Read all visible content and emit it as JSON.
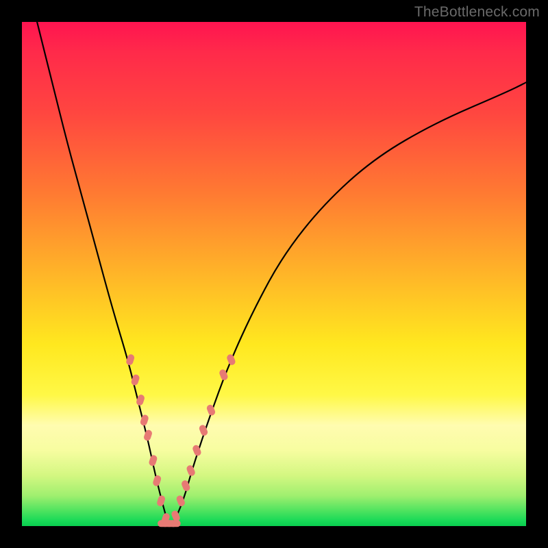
{
  "watermark": "TheBottleneck.com",
  "colors": {
    "frame": "#000000",
    "curve": "#000000",
    "marker": "#e77a74",
    "gradient_top": "#ff1450",
    "gradient_bottom": "#0ace50"
  },
  "chart_data": {
    "type": "line",
    "title": "",
    "xlabel": "",
    "ylabel": "",
    "xlim": [
      0,
      100
    ],
    "ylim": [
      0,
      100
    ],
    "series": [
      {
        "name": "bottleneck-curve",
        "x": [
          3,
          6,
          9,
          12,
          15,
          18,
          21,
          23,
          25,
          26.5,
          28,
          29,
          30,
          32,
          34,
          37,
          41,
          46,
          52,
          60,
          70,
          82,
          96,
          100
        ],
        "y": [
          100,
          88,
          76,
          65,
          54,
          43,
          33,
          25,
          17,
          10,
          4,
          0.5,
          0.5,
          5,
          12,
          21,
          32,
          43,
          54,
          64,
          73,
          80,
          86,
          88
        ]
      }
    ],
    "markers": [
      {
        "name": "left-arm",
        "points": [
          {
            "x": 21.5,
            "y": 33
          },
          {
            "x": 22.5,
            "y": 29
          },
          {
            "x": 23.5,
            "y": 25
          },
          {
            "x": 24.3,
            "y": 21
          },
          {
            "x": 25.0,
            "y": 18
          },
          {
            "x": 26.0,
            "y": 13
          },
          {
            "x": 26.8,
            "y": 9
          },
          {
            "x": 27.6,
            "y": 5
          },
          {
            "x": 28.5,
            "y": 1.5
          }
        ]
      },
      {
        "name": "right-arm",
        "points": [
          {
            "x": 30.5,
            "y": 2
          },
          {
            "x": 31.5,
            "y": 5
          },
          {
            "x": 32.5,
            "y": 8
          },
          {
            "x": 33.5,
            "y": 11
          },
          {
            "x": 34.7,
            "y": 15
          },
          {
            "x": 36.0,
            "y": 19
          },
          {
            "x": 37.5,
            "y": 23
          },
          {
            "x": 40.0,
            "y": 30
          },
          {
            "x": 41.5,
            "y": 33
          }
        ]
      },
      {
        "name": "valley-floor",
        "points": [
          {
            "x": 28.0,
            "y": 0.5
          },
          {
            "x": 28.8,
            "y": 0.5
          },
          {
            "x": 29.6,
            "y": 0.5
          },
          {
            "x": 30.4,
            "y": 0.5
          }
        ]
      }
    ]
  }
}
